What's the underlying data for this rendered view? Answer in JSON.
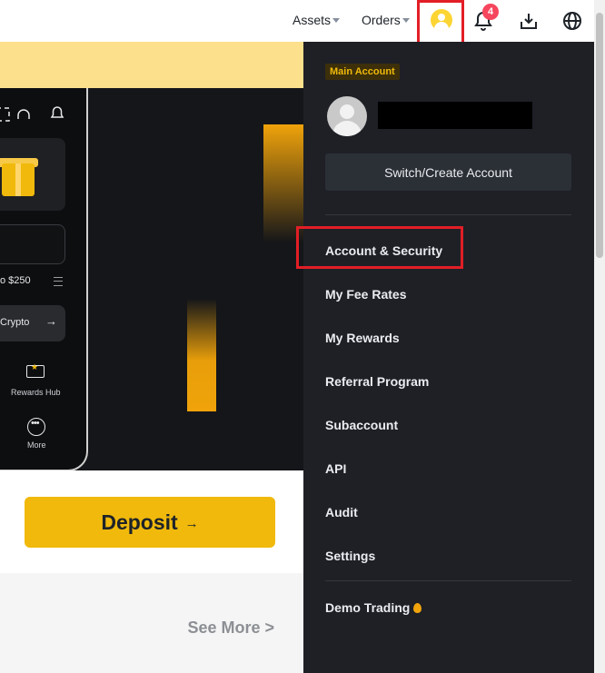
{
  "nav": {
    "assets_label": "Assets",
    "orders_label": "Orders",
    "notification_count": "4"
  },
  "hero": {
    "promo_text": "o $250",
    "crypto_label": "Crypto",
    "rewards_label": "Rewards Hub",
    "more_label": "More"
  },
  "deposit": {
    "label": "Deposit"
  },
  "see_more": "See More >",
  "dropdown": {
    "account_badge": "Main Account",
    "switch_label": "Switch/Create Account",
    "items": [
      {
        "label": "Account & Security"
      },
      {
        "label": "My Fee Rates"
      },
      {
        "label": "My Rewards"
      },
      {
        "label": "Referral Program"
      },
      {
        "label": "Subaccount"
      },
      {
        "label": "API"
      },
      {
        "label": "Audit"
      },
      {
        "label": "Settings"
      }
    ],
    "demo_label": "Demo Trading"
  },
  "colors": {
    "accent": "#f0b90b",
    "panel_bg": "#1e2026",
    "highlight": "#e21e26",
    "badge": "#f6465d"
  },
  "icons": [
    "user-avatar-icon",
    "bell-icon",
    "download-icon",
    "globe-icon",
    "scan-icon",
    "headset-icon",
    "gift-icon",
    "ticket-icon",
    "more-icon",
    "flame-icon"
  ]
}
